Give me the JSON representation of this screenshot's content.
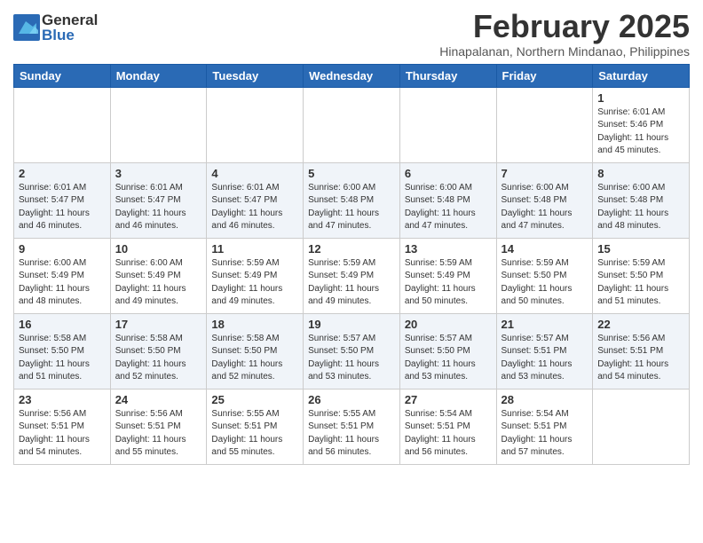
{
  "header": {
    "logo_general": "General",
    "logo_blue": "Blue",
    "month_title": "February 2025",
    "location": "Hinapalanan, Northern Mindanao, Philippines"
  },
  "weekdays": [
    "Sunday",
    "Monday",
    "Tuesday",
    "Wednesday",
    "Thursday",
    "Friday",
    "Saturday"
  ],
  "weeks": [
    [
      {
        "day": "",
        "info": ""
      },
      {
        "day": "",
        "info": ""
      },
      {
        "day": "",
        "info": ""
      },
      {
        "day": "",
        "info": ""
      },
      {
        "day": "",
        "info": ""
      },
      {
        "day": "",
        "info": ""
      },
      {
        "day": "1",
        "info": "Sunrise: 6:01 AM\nSunset: 5:46 PM\nDaylight: 11 hours\nand 45 minutes."
      }
    ],
    [
      {
        "day": "2",
        "info": "Sunrise: 6:01 AM\nSunset: 5:47 PM\nDaylight: 11 hours\nand 46 minutes."
      },
      {
        "day": "3",
        "info": "Sunrise: 6:01 AM\nSunset: 5:47 PM\nDaylight: 11 hours\nand 46 minutes."
      },
      {
        "day": "4",
        "info": "Sunrise: 6:01 AM\nSunset: 5:47 PM\nDaylight: 11 hours\nand 46 minutes."
      },
      {
        "day": "5",
        "info": "Sunrise: 6:00 AM\nSunset: 5:48 PM\nDaylight: 11 hours\nand 47 minutes."
      },
      {
        "day": "6",
        "info": "Sunrise: 6:00 AM\nSunset: 5:48 PM\nDaylight: 11 hours\nand 47 minutes."
      },
      {
        "day": "7",
        "info": "Sunrise: 6:00 AM\nSunset: 5:48 PM\nDaylight: 11 hours\nand 47 minutes."
      },
      {
        "day": "8",
        "info": "Sunrise: 6:00 AM\nSunset: 5:48 PM\nDaylight: 11 hours\nand 48 minutes."
      }
    ],
    [
      {
        "day": "9",
        "info": "Sunrise: 6:00 AM\nSunset: 5:49 PM\nDaylight: 11 hours\nand 48 minutes."
      },
      {
        "day": "10",
        "info": "Sunrise: 6:00 AM\nSunset: 5:49 PM\nDaylight: 11 hours\nand 49 minutes."
      },
      {
        "day": "11",
        "info": "Sunrise: 5:59 AM\nSunset: 5:49 PM\nDaylight: 11 hours\nand 49 minutes."
      },
      {
        "day": "12",
        "info": "Sunrise: 5:59 AM\nSunset: 5:49 PM\nDaylight: 11 hours\nand 49 minutes."
      },
      {
        "day": "13",
        "info": "Sunrise: 5:59 AM\nSunset: 5:49 PM\nDaylight: 11 hours\nand 50 minutes."
      },
      {
        "day": "14",
        "info": "Sunrise: 5:59 AM\nSunset: 5:50 PM\nDaylight: 11 hours\nand 50 minutes."
      },
      {
        "day": "15",
        "info": "Sunrise: 5:59 AM\nSunset: 5:50 PM\nDaylight: 11 hours\nand 51 minutes."
      }
    ],
    [
      {
        "day": "16",
        "info": "Sunrise: 5:58 AM\nSunset: 5:50 PM\nDaylight: 11 hours\nand 51 minutes."
      },
      {
        "day": "17",
        "info": "Sunrise: 5:58 AM\nSunset: 5:50 PM\nDaylight: 11 hours\nand 52 minutes."
      },
      {
        "day": "18",
        "info": "Sunrise: 5:58 AM\nSunset: 5:50 PM\nDaylight: 11 hours\nand 52 minutes."
      },
      {
        "day": "19",
        "info": "Sunrise: 5:57 AM\nSunset: 5:50 PM\nDaylight: 11 hours\nand 53 minutes."
      },
      {
        "day": "20",
        "info": "Sunrise: 5:57 AM\nSunset: 5:50 PM\nDaylight: 11 hours\nand 53 minutes."
      },
      {
        "day": "21",
        "info": "Sunrise: 5:57 AM\nSunset: 5:51 PM\nDaylight: 11 hours\nand 53 minutes."
      },
      {
        "day": "22",
        "info": "Sunrise: 5:56 AM\nSunset: 5:51 PM\nDaylight: 11 hours\nand 54 minutes."
      }
    ],
    [
      {
        "day": "23",
        "info": "Sunrise: 5:56 AM\nSunset: 5:51 PM\nDaylight: 11 hours\nand 54 minutes."
      },
      {
        "day": "24",
        "info": "Sunrise: 5:56 AM\nSunset: 5:51 PM\nDaylight: 11 hours\nand 55 minutes."
      },
      {
        "day": "25",
        "info": "Sunrise: 5:55 AM\nSunset: 5:51 PM\nDaylight: 11 hours\nand 55 minutes."
      },
      {
        "day": "26",
        "info": "Sunrise: 5:55 AM\nSunset: 5:51 PM\nDaylight: 11 hours\nand 56 minutes."
      },
      {
        "day": "27",
        "info": "Sunrise: 5:54 AM\nSunset: 5:51 PM\nDaylight: 11 hours\nand 56 minutes."
      },
      {
        "day": "28",
        "info": "Sunrise: 5:54 AM\nSunset: 5:51 PM\nDaylight: 11 hours\nand 57 minutes."
      },
      {
        "day": "",
        "info": ""
      }
    ]
  ]
}
